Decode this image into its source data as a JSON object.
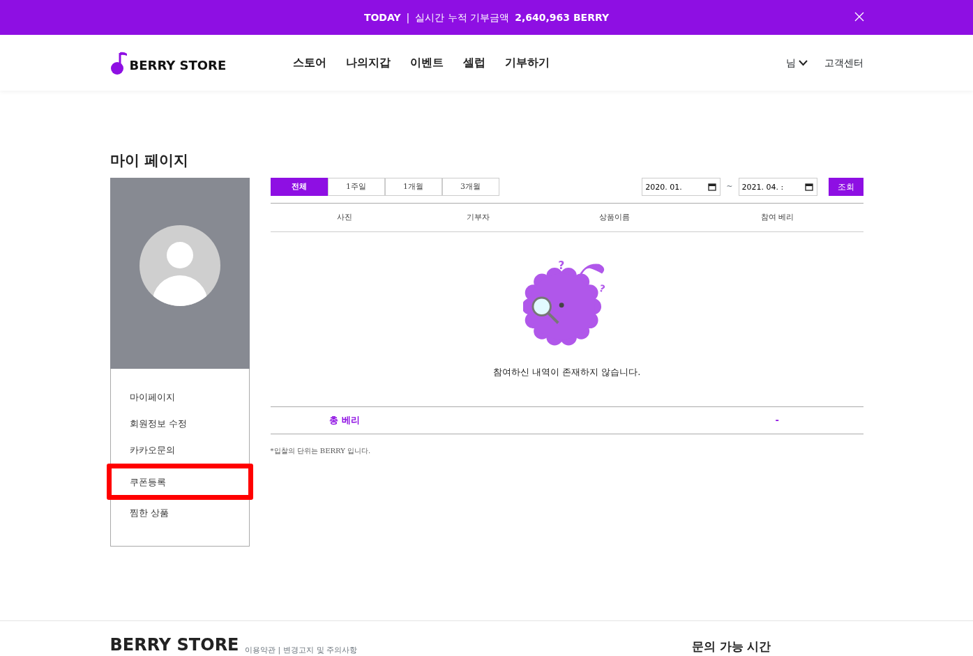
{
  "top_banner": {
    "label": "TODAY",
    "separator": "|",
    "text": "실시간 누적 기부금액",
    "amount": "2,640,963 BERRY"
  },
  "header": {
    "logo": "BERRY STORE",
    "nav": [
      "스토어",
      "나의지갑",
      "이벤트",
      "셀럽",
      "기부하기"
    ],
    "user": "님",
    "support": "고객센터"
  },
  "page_title": "마이 페이지",
  "sidebar": {
    "items": [
      {
        "label": "마이페이지",
        "highlighted": false
      },
      {
        "label": "회원정보 수정",
        "highlighted": false
      },
      {
        "label": "카카오문의",
        "highlighted": false
      },
      {
        "label": "쿠폰등록",
        "highlighted": true
      },
      {
        "label": "찜한 상품",
        "highlighted": false
      }
    ]
  },
  "filter": {
    "tabs": [
      {
        "label": "전체",
        "selected": true
      },
      {
        "label": "1주일",
        "selected": false
      },
      {
        "label": "1개월",
        "selected": false
      },
      {
        "label": "3개월",
        "selected": false
      }
    ],
    "start_date": "2020. 01. ",
    "separator": "~",
    "end_date": "2021. 04. :",
    "search_button": "조회"
  },
  "table": {
    "columns": [
      "사진",
      "기부자",
      "상품이름",
      "참여 베리"
    ],
    "mascot_marks": [
      "?",
      "?"
    ],
    "empty_message": "참여하신 내역이 존재하지 않습니다."
  },
  "total": {
    "label": "총 베리",
    "value": "-"
  },
  "note": "*입찰의 단위는 BERRY 입니다.",
  "footer": {
    "logo": "BERRY STORE",
    "links": [
      "이용약관",
      "|",
      "변경고지 및 주의사항"
    ],
    "contact_title": "문의 가능 시간"
  }
}
